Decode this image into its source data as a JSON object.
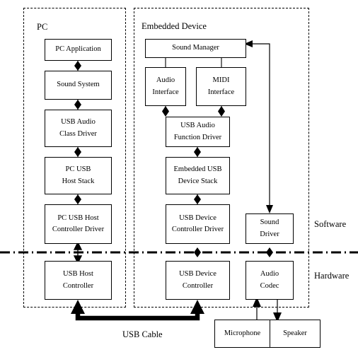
{
  "diagram": {
    "title_caption": "USB Cable",
    "regions": [
      {
        "id": "pc",
        "label": "PC"
      },
      {
        "id": "embedded",
        "label": "Embedded Device"
      }
    ],
    "layer_labels": {
      "software": "Software",
      "hardware": "Hardware"
    },
    "nodes": [
      {
        "id": "pc-application",
        "lines": [
          "PC Application"
        ]
      },
      {
        "id": "sound-system",
        "lines": [
          "Sound System"
        ]
      },
      {
        "id": "usb-audio-class-driver",
        "lines": [
          "USB Audio",
          "Class Driver"
        ]
      },
      {
        "id": "pc-usb-host-stack",
        "lines": [
          "PC USB",
          "Host Stack"
        ]
      },
      {
        "id": "pc-usb-host-controller-driver",
        "lines": [
          "PC USB Host",
          "Controller Driver"
        ]
      },
      {
        "id": "usb-host-controller",
        "lines": [
          "USB Host",
          "Controller"
        ]
      },
      {
        "id": "sound-manager",
        "lines": [
          "Sound Manager"
        ]
      },
      {
        "id": "audio-interface",
        "lines": [
          "Audio",
          "Interface"
        ]
      },
      {
        "id": "midi-interface",
        "lines": [
          "MIDI",
          "Interface"
        ]
      },
      {
        "id": "usb-audio-function-driver",
        "lines": [
          "USB Audio",
          "Function Driver"
        ]
      },
      {
        "id": "embedded-usb-device-stack",
        "lines": [
          "Embedded USB",
          "Device Stack"
        ]
      },
      {
        "id": "usb-device-controller-driver",
        "lines": [
          "USB Device",
          "Controller Driver"
        ]
      },
      {
        "id": "usb-device-controller",
        "lines": [
          "USB Device",
          "Controller"
        ]
      },
      {
        "id": "sound-driver",
        "lines": [
          "Sound",
          "Driver"
        ]
      },
      {
        "id": "audio-codec",
        "lines": [
          "Audio",
          "Codec"
        ]
      },
      {
        "id": "microphone",
        "lines": [
          "Microphone"
        ]
      },
      {
        "id": "speaker",
        "lines": [
          "Speaker"
        ]
      }
    ],
    "colors": {
      "stroke": "#000000",
      "background": "#ffffff"
    }
  }
}
